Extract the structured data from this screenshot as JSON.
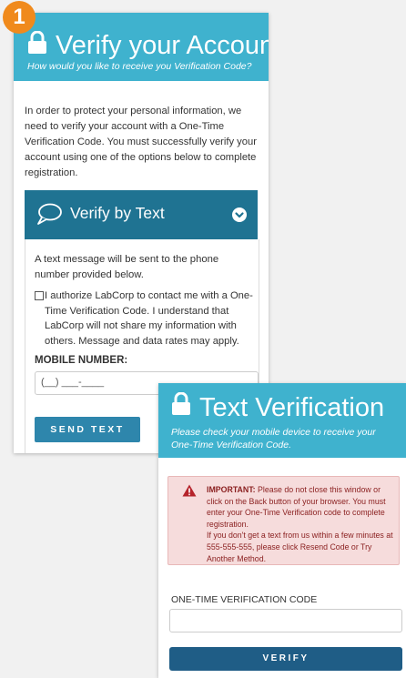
{
  "step_number": "1",
  "account": {
    "title": "Verify your Account",
    "subtitle": "How would you like to receive you Verification Code?",
    "intro": "In order to protect your personal information, we need to verify your account with a One-Time Verification Code. You must successfully verify your account using one of the options below to complete registration.",
    "section_title": "Verify by Text",
    "text_message": "A text message will be sent to the phone number provided below.",
    "consent_text": "I authorize LabCorp to contact me with a One-Time Verification Code. I understand that LabCorp will not share my information with others. Message and data rates may apply.",
    "mobile_label": "MOBILE NUMBER:",
    "mobile_placeholder": "(__) ___-____",
    "send_button": "SEND TEXT"
  },
  "text_verification": {
    "title": "Text Verification",
    "subtitle": "Please check your mobile device to receive your One-Time Verification Code.",
    "alert_strong": "IMPORTANT:",
    "alert_text": " Please do not close this window or click on the Back button of your browser. You must enter your One-Time Verification code to complete registration.",
    "alert_text2": "If you don't get a text from us within a few minutes at 555-555-555, please click Resend Code or Try Another Method.",
    "otp_label": "ONE-TIME VERIFICATION CODE",
    "verify_button": "VERIFY"
  },
  "colors": {
    "header": "#3fb2ce",
    "section": "#1f7392",
    "badge": "#f08a1c",
    "alert_bg": "#f6dcdc",
    "verify": "#1f5d86"
  },
  "icons": [
    "lock-icon",
    "chat-bubble-icon",
    "chevron-down-icon",
    "warning-icon"
  ]
}
